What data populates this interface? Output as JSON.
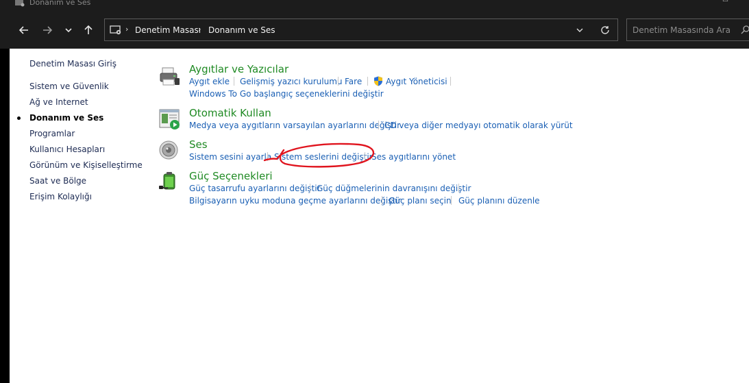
{
  "window": {
    "title": "Donanım ve Ses"
  },
  "address_bar": {
    "breadcrumbs": [
      "Denetim Masası",
      "Donanım ve Ses"
    ]
  },
  "search": {
    "placeholder": "Denetim Masasında Ara"
  },
  "sidebar": {
    "items": [
      {
        "label": "Denetim Masası Giriş",
        "active": false
      },
      {
        "label": "Sistem ve Güvenlik",
        "active": false
      },
      {
        "label": "Ağ ve Internet",
        "active": false
      },
      {
        "label": "Donanım ve Ses",
        "active": true
      },
      {
        "label": "Programlar",
        "active": false
      },
      {
        "label": "Kullanıcı Hesapları",
        "active": false
      },
      {
        "label": "Görünüm ve Kişiselleştirme",
        "active": false
      },
      {
        "label": "Saat ve Bölge",
        "active": false
      },
      {
        "label": "Erişim Kolaylığı",
        "active": false
      }
    ]
  },
  "categories": [
    {
      "title": "Aygıtlar ve Yazıcılar",
      "icon": "printer-icon",
      "tasks": [
        "Aygıt ekle",
        "Gelişmiş yazıcı kurulumu",
        "Fare",
        "Aygıt Yöneticisi",
        "Windows To Go başlangıç seçeneklerini değiştir"
      ]
    },
    {
      "title": "Otomatik Kullan",
      "icon": "autoplay-icon",
      "tasks": [
        "Medya veya aygıtların varsayılan ayarlarını değiştir",
        "CD veya diğer medyayı otomatik olarak yürüt"
      ]
    },
    {
      "title": "Ses",
      "icon": "speaker-icon",
      "tasks": [
        "Sistem sesini ayarla",
        "Sistem seslerini değiştir",
        "Ses aygıtlarını yönet"
      ]
    },
    {
      "title": "Güç Seçenekleri",
      "icon": "battery-icon",
      "tasks": [
        "Güç tasarrufu ayarlarını değiştir",
        "Güç düğmelerinin davranışını değiştir",
        "Bilgisayarın uyku moduna geçme ayarlarını değiştir",
        "Güç planı seçin",
        "Güç planını düzenle"
      ]
    }
  ],
  "colors": {
    "category_title": "#1f8a23",
    "task_link": "#1a5fb4",
    "annotation": "#e0141e"
  }
}
